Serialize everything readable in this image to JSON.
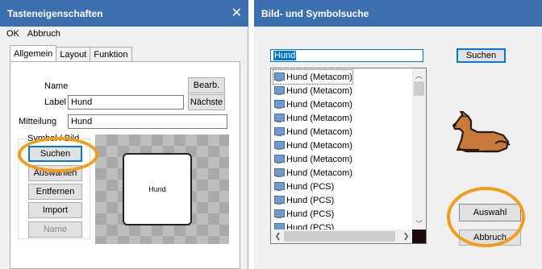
{
  "left_dialog": {
    "title": "Tasteneigenschaften",
    "menu": {
      "ok": "OK",
      "cancel": "Abbruch"
    },
    "tabs": [
      "Allgemein",
      "Layout",
      "Funktion"
    ],
    "name_label": "Name",
    "edit_button": "Bearb.",
    "label_label": "Label",
    "label_value": "Hund",
    "next_button": "Nächste",
    "message_label": "Mitteilung",
    "message_value": "Hund",
    "group_title": "Symbol / Bild",
    "buttons": {
      "search": "Suchen",
      "select": "Auswählen",
      "remove": "Entfernen",
      "import": "Import",
      "name": "Name"
    },
    "preview_text": "Hund"
  },
  "right_dialog": {
    "title": "Bild- und Symbolsuche",
    "search_value": "Hund",
    "search_button": "Suchen",
    "results": [
      "Hund (Metacom)",
      "Hund (Metacom)",
      "Hund (Metacom)",
      "Hund (Metacom)",
      "Hund (Metacom)",
      "Hund (Metacom)",
      "Hund (Metacom)",
      "Hund (Metacom)",
      "Hund (PCS)",
      "Hund (PCS)",
      "Hund (PCS)",
      "Hund (PCS)"
    ],
    "select_button": "Auswahl",
    "cancel_button": "Abbruch"
  },
  "colors": {
    "titlebar": "#3b6fb0",
    "highlight_ring": "#f39c19",
    "selection": "#0078d7"
  }
}
